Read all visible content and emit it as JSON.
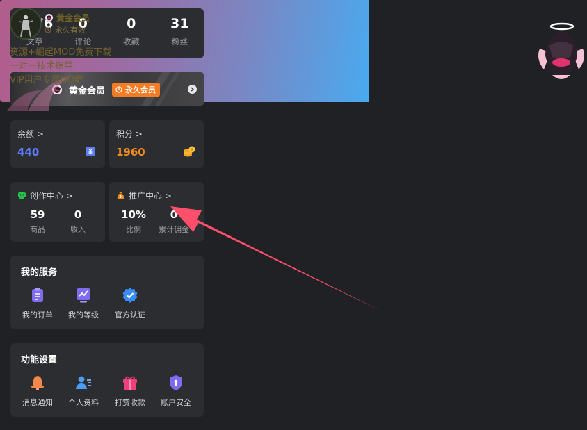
{
  "stats": [
    {
      "value": "1676",
      "label": "文章"
    },
    {
      "value": "0",
      "label": "评论"
    },
    {
      "value": "0",
      "label": "收藏"
    },
    {
      "value": "31",
      "label": "粉丝"
    }
  ],
  "vip": {
    "title": "黄金会员",
    "badge": "永久会员"
  },
  "wallet": {
    "balance": {
      "title": "余额 >",
      "value": "440",
      "color": "#5b7cf7"
    },
    "points": {
      "title": "积分 >",
      "value": "1960",
      "color": "#f28a1e"
    }
  },
  "creator": {
    "title": "创作中心 >",
    "items": [
      {
        "value": "59",
        "label": "商品"
      },
      {
        "value": "0",
        "label": "收入"
      }
    ]
  },
  "promo": {
    "title": "推广中心 >",
    "items": [
      {
        "value": "10%",
        "label": "比例"
      },
      {
        "value": "0",
        "label": "累计佣金"
      }
    ]
  },
  "services": {
    "title": "我的服务",
    "items": [
      {
        "label": "我的订单",
        "icon": "order-icon"
      },
      {
        "label": "我的等级",
        "icon": "level-icon"
      },
      {
        "label": "官方认证",
        "icon": "verified-icon"
      }
    ]
  },
  "settings": {
    "title": "功能设置",
    "items": [
      {
        "label": "消息通知",
        "icon": "bell-icon"
      },
      {
        "label": "个人资料",
        "icon": "profile-icon"
      },
      {
        "label": "打赏收款",
        "icon": "gift-icon"
      },
      {
        "label": "账户安全",
        "icon": "shield-icon"
      }
    ]
  },
  "banner": {
    "username": "黄金会员",
    "validity": "永久有效",
    "perks": [
      "资源+崛起MOD免费下载",
      "一对一技术指导",
      "VIP用户专属QQ群"
    ]
  }
}
